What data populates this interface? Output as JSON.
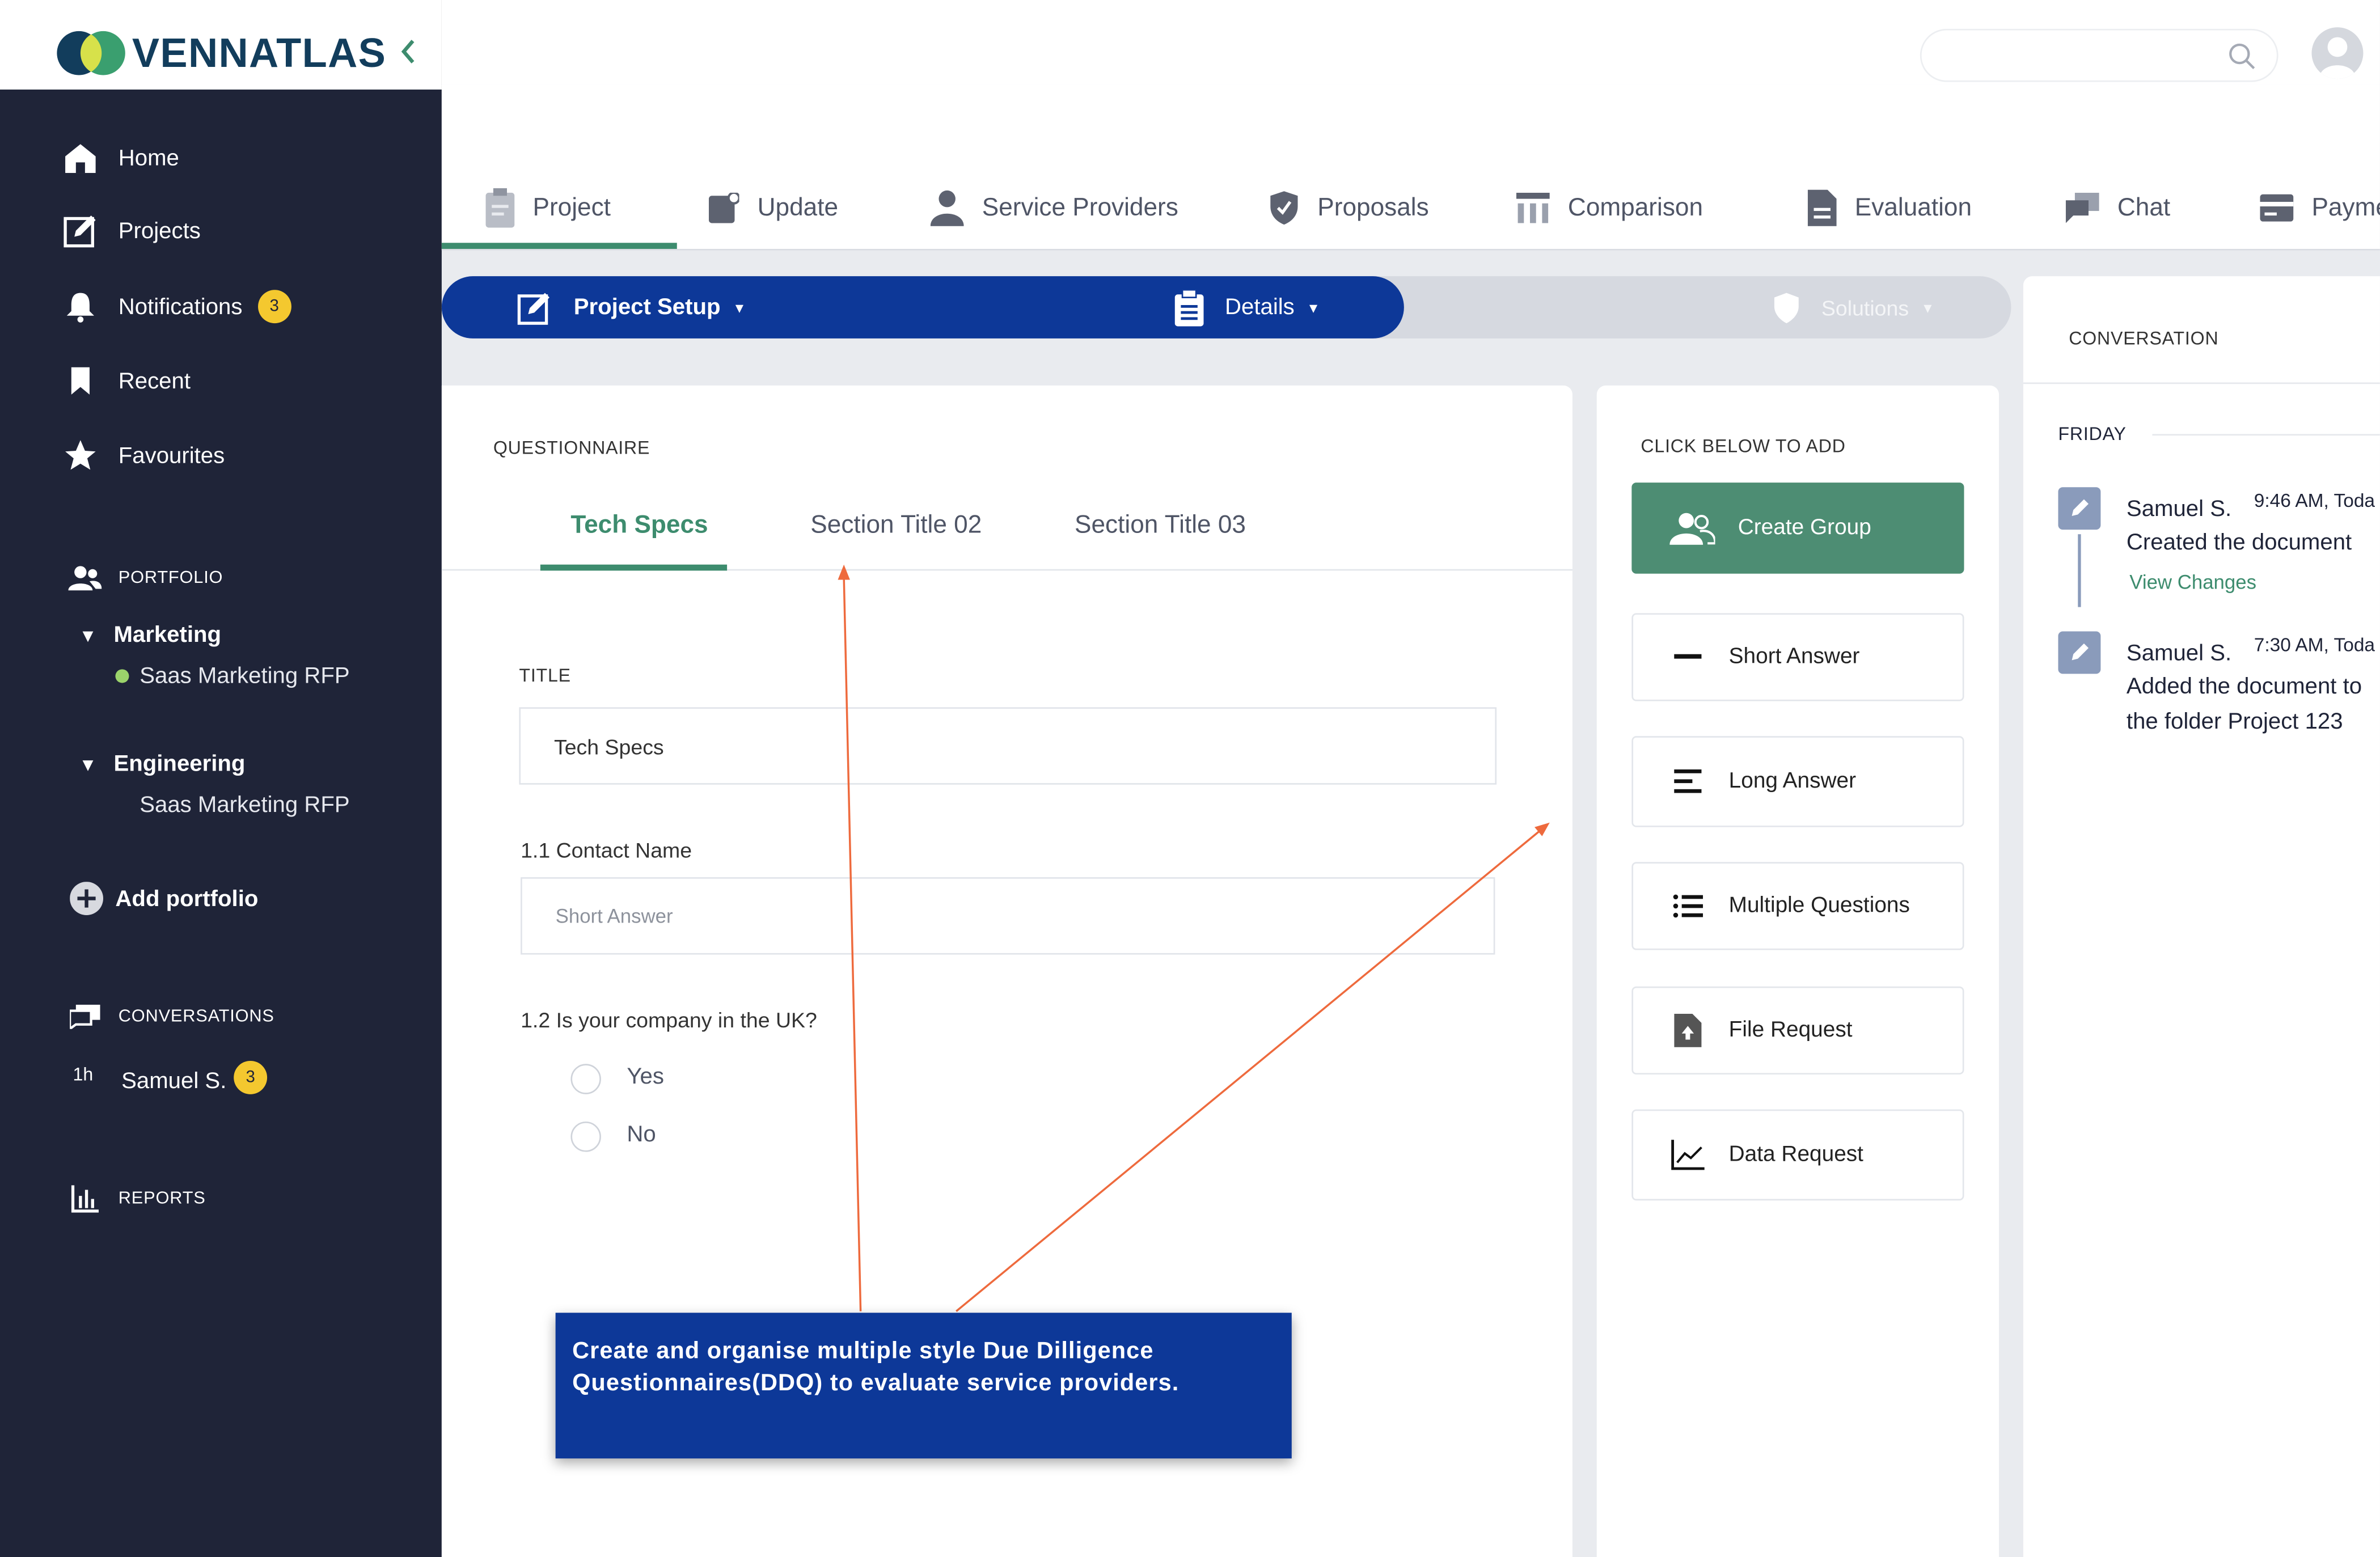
{
  "brand": {
    "name": "VENNATLAS"
  },
  "sidebar": {
    "nav": [
      {
        "label": "Home",
        "icon": "home-icon"
      },
      {
        "label": "Projects",
        "icon": "edit-icon"
      },
      {
        "label": "Notifications",
        "icon": "bell-icon",
        "badge": "3"
      },
      {
        "label": "Recent",
        "icon": "bookmark-icon"
      },
      {
        "label": "Favourites",
        "icon": "star-icon"
      }
    ],
    "portfolio": {
      "heading": "PORTFOLIO",
      "groups": [
        {
          "name": "Marketing",
          "items": [
            "Saas Marketing RFP"
          ]
        },
        {
          "name": "Engineering",
          "items": [
            "Saas Marketing RFP"
          ]
        }
      ],
      "add_label": "Add portfolio"
    },
    "conversations": {
      "heading": "CONVERSATIONS",
      "items": [
        {
          "time": "1h",
          "name": "Samuel S.",
          "badge": "3"
        }
      ]
    },
    "reports": {
      "heading": "REPORTS"
    }
  },
  "top_tabs": [
    {
      "label": "Project",
      "icon": "clipboard-icon",
      "active": true
    },
    {
      "label": "Update",
      "icon": "update-icon"
    },
    {
      "label": "Service Providers",
      "icon": "person-icon"
    },
    {
      "label": "Proposals",
      "icon": "shield-icon"
    },
    {
      "label": "Comparison",
      "icon": "table-icon"
    },
    {
      "label": "Evaluation",
      "icon": "document-icon"
    },
    {
      "label": "Chat",
      "icon": "chat-icon"
    },
    {
      "label": "Payme",
      "icon": "payment-icon"
    }
  ],
  "steps": {
    "project_setup": "Project Setup",
    "details": "Details",
    "solutions": "Solutions"
  },
  "questionnaire": {
    "heading": "QUESTIONNAIRE",
    "tabs": [
      "Tech Specs",
      "Section Title 02",
      "Section Title 03"
    ],
    "title_label": "TITLE",
    "title_value": "Tech Specs",
    "q1_label": "1.1 Contact Name",
    "q1_placeholder": "Short Answer",
    "q2_label": "1.2 Is your company in the UK?",
    "q2_options": [
      "Yes",
      "No"
    ]
  },
  "add_panel": {
    "heading": "CLICK BELOW TO ADD",
    "buttons": [
      {
        "label": "Create Group",
        "icon": "group-icon"
      },
      {
        "label": "Short Answer",
        "icon": "short-answer-icon"
      },
      {
        "label": "Long Answer",
        "icon": "long-answer-icon"
      },
      {
        "label": "Multiple Questions",
        "icon": "list-icon"
      },
      {
        "label": "File Request",
        "icon": "file-upload-icon"
      },
      {
        "label": "Data Request",
        "icon": "chart-icon"
      }
    ]
  },
  "conversation_panel": {
    "heading": "CONVERSATION",
    "day": "FRIDAY",
    "entries": [
      {
        "name": "Samuel S.",
        "time": "9:46 AM, Toda",
        "text_lines": [
          "Created the document"
        ],
        "link": "View Changes"
      },
      {
        "name": "Samuel S.",
        "time": "7:30 AM, Toda",
        "text_lines": [
          "Added the document to",
          "the folder Project 123"
        ]
      }
    ]
  },
  "callout": {
    "text_lines": [
      "Create and organise multiple style Due Dilligence",
      "Questionnaires(DDQ) to evaluate service providers."
    ]
  },
  "colors": {
    "sidebar_bg": "#1f2438",
    "primary_blue": "#0d3898",
    "accent_green": "#3d8c6e",
    "badge_yellow": "#f4c82f",
    "annotation_orange": "#ee6a3d"
  }
}
